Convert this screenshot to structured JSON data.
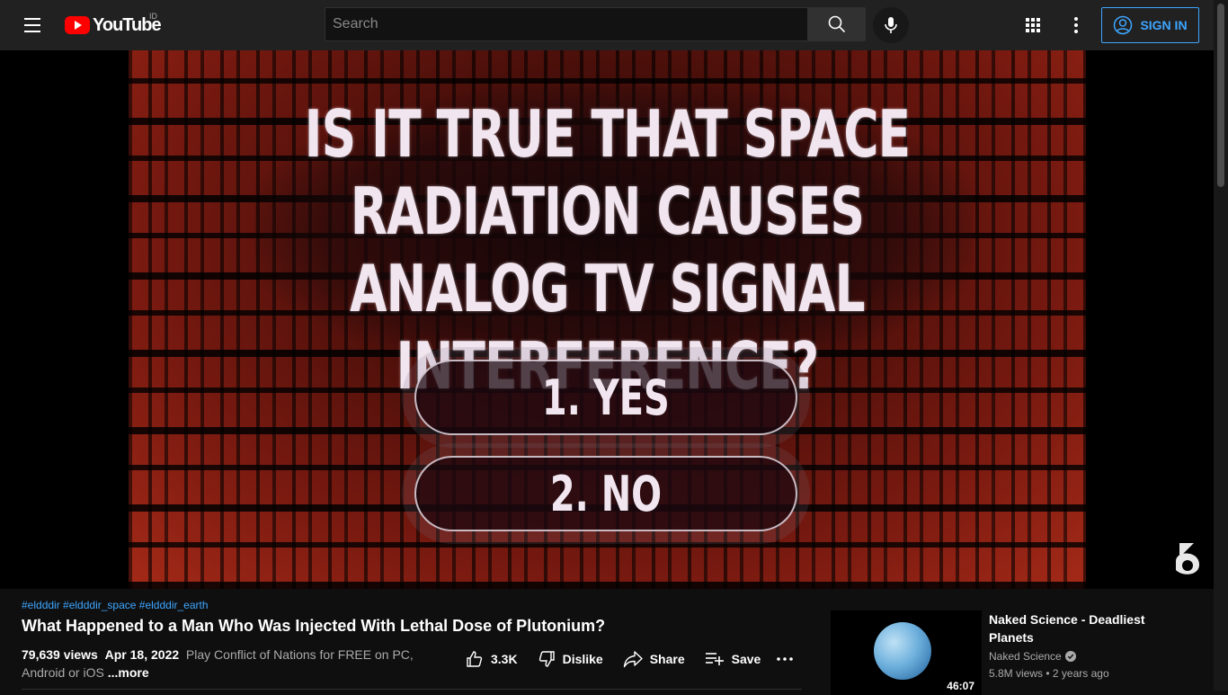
{
  "header": {
    "logo_text": "YouTube",
    "country_code": "ID",
    "search_placeholder": "Search",
    "signin_label": "SIGN IN"
  },
  "player": {
    "question": "IS IT TRUE THAT SPACE RADIATION CAUSES ANALOG TV SIGNAL INTERFERENCE?",
    "option1": "1. YES",
    "option2": "2. NO"
  },
  "video": {
    "hashtags": [
      "#eldddir",
      "#eldddir_space",
      "#eldddir_earth"
    ],
    "title": "What Happened to a Man Who Was Injected With Lethal Dose of Plutonium?",
    "views": "79,639 views",
    "date": "Apr 18, 2022",
    "description_snippet": "Play Conflict of Nations for FREE on PC, Android or iOS",
    "more_label": "...more",
    "likes": "3.3K",
    "dislike_label": "Dislike",
    "share_label": "Share",
    "save_label": "Save"
  },
  "recommendation": {
    "title": "Naked Science - Deadliest Planets",
    "channel": "Naked Science",
    "views": "5.8M views",
    "age": "2 years ago",
    "duration": "46:07"
  }
}
